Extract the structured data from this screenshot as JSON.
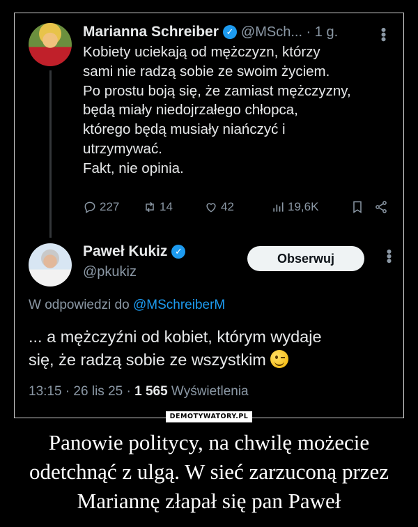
{
  "tweet1": {
    "author_name": "Marianna Schreiber",
    "handle_time": "@MSch... · 1 g.",
    "body_lines": [
      "Kobiety uciekają od mężczyzn, którzy",
      "sami nie radzą sobie ze swoim życiem.",
      "Po prostu boją się, że zamiast mężczyzny,",
      "będą miały niedojrzałego chłopca,",
      "którego będą musiały niańczyć i",
      "utrzymywać.",
      "Fakt, nie opinia."
    ],
    "replies": "227",
    "retweets": "14",
    "likes": "42",
    "views": "19,6K"
  },
  "tweet2": {
    "author_name": "Paweł Kukiz",
    "handle": "@pkukiz",
    "follow_label": "Obserwuj",
    "reply_prefix": "W odpowiedzi do",
    "reply_mention": "@MSchreiberM",
    "body_lines": [
      "... a mężczyźni od kobiet, którym wydaje",
      "się, że radzą sobie ze wszystkim"
    ],
    "time_date": "13:15 · 26 lis 25 ·",
    "views_count": "1 565",
    "views_label": "Wyświetlenia"
  },
  "watermark": "DEMOTYWATORY.PL",
  "caption_lines": [
    "Panowie politycy, na chwilę możecie",
    "odetchnąć z ulgą. W sieć zarzuconą przez",
    "Mariannę złapał się pan Paweł"
  ],
  "colors": {
    "accent_blue": "#1d9bf0",
    "muted_text": "#8b98a5",
    "primary_text": "#e7e9ea"
  }
}
